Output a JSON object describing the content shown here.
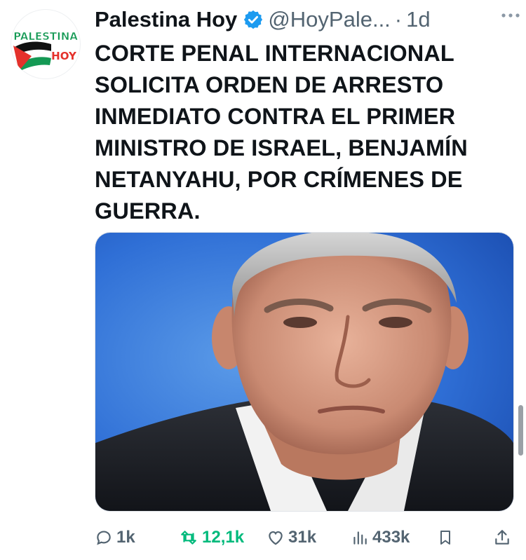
{
  "author": {
    "name": "Palestina Hoy",
    "handle": "@HoyPale...",
    "separator": "·",
    "time": "1d",
    "avatar_text_top": "PALESTINA",
    "avatar_text_bottom": "HOY"
  },
  "tweet": {
    "text": "CORTE PENAL INTERNACIONAL SOLICITA ORDEN DE ARRESTO INMEDIATO CONTRA EL PRIMER MINISTRO DE ISRAEL, BENJAMÍN NETANYAHU, POR CRÍMENES DE GUERRA."
  },
  "actions": {
    "replies": "1k",
    "retweets": "12,1k",
    "likes": "31k",
    "views": "433k"
  },
  "icons": {
    "verified": "verified-badge-icon",
    "more": "more-options-icon",
    "reply": "reply-icon",
    "retweet": "retweet-icon",
    "like": "heart-icon",
    "views": "views-chart-icon",
    "bookmark": "bookmark-icon",
    "share": "share-icon"
  },
  "colors": {
    "text": "#0f1419",
    "secondary": "#536471",
    "verified": "#1d9bf0",
    "retweet_active": "#00ba7c",
    "flag_red": "#e4312b",
    "flag_green": "#149954"
  }
}
